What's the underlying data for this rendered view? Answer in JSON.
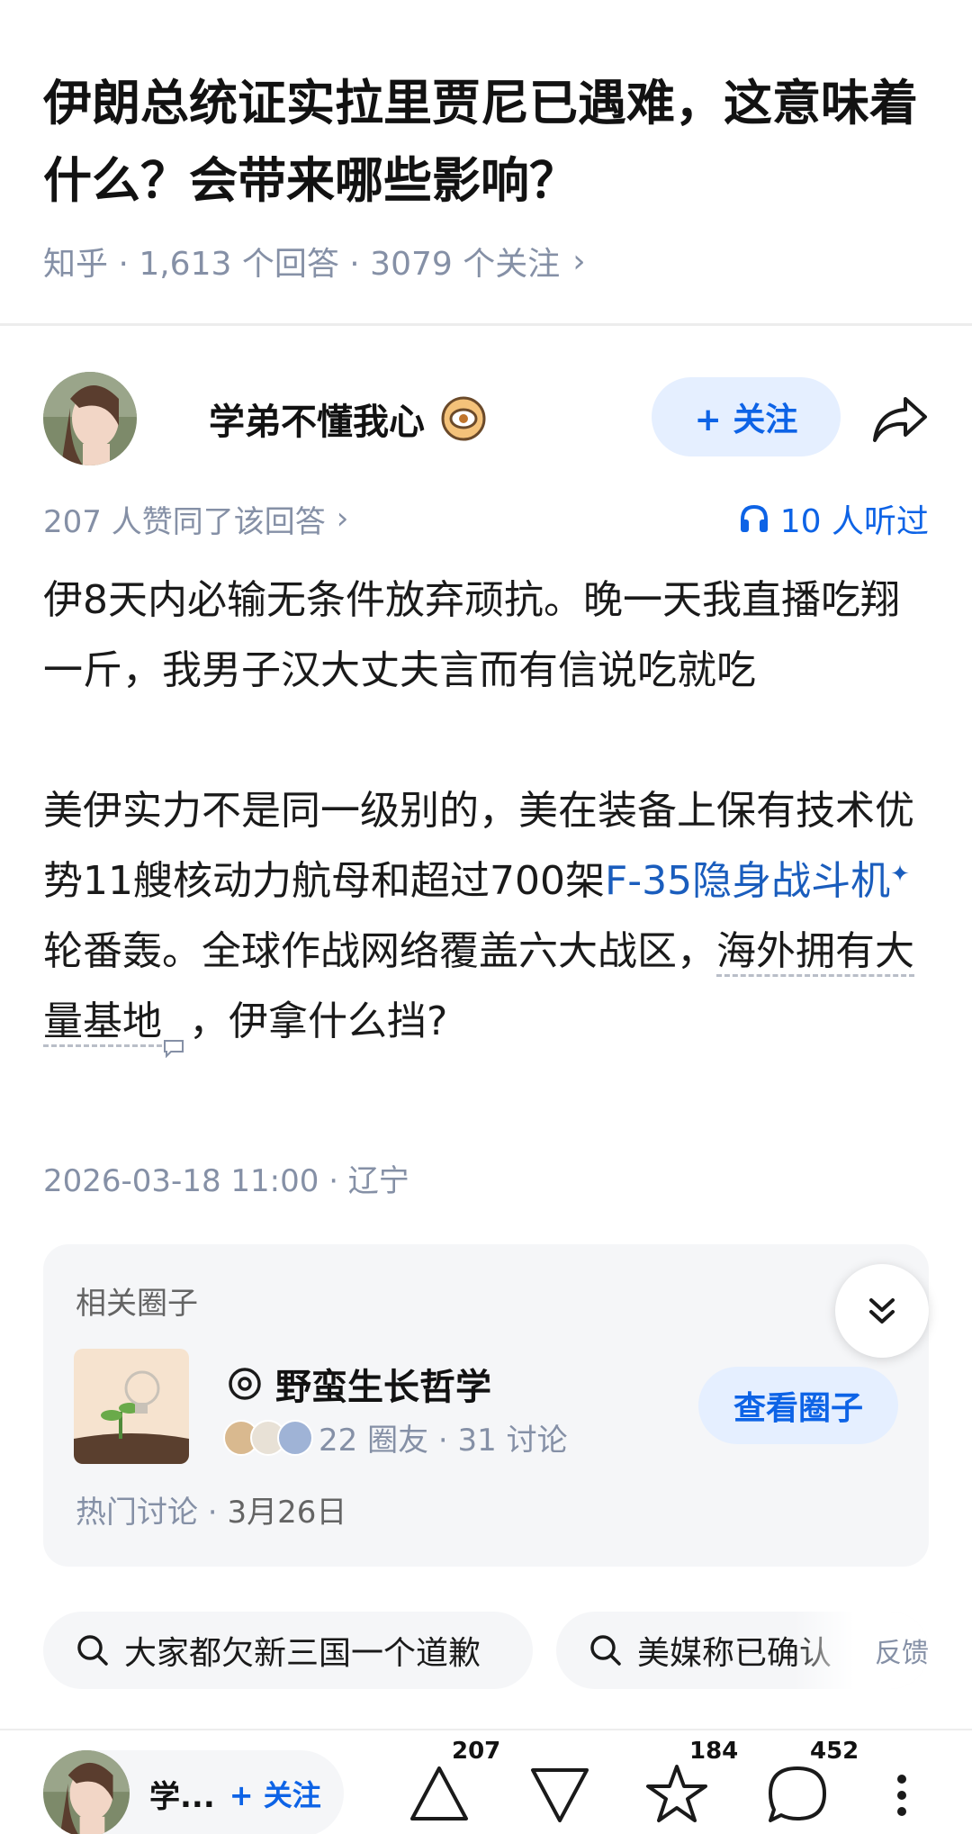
{
  "question": {
    "title": "伊朗总统证实拉里贾尼已遇难，这意味着什么？会带来哪些影响？",
    "meta": "知乎 · 1,613 个回答 · 3079 个关注",
    "chevron": "›"
  },
  "answer": {
    "author_name": "学弟不懂我心",
    "follow_label": "+ 关注",
    "vote_summary": "207 人赞同了该回答",
    "chevron": "›",
    "listen_text": "10 人听过",
    "content": {
      "p1": "伊8天内必输无条件放弃顽抗。晚一天我直播吃翔一斤，我男子汉大丈夫言而有信说吃就吃",
      "p2_a": "美伊实力不是同一级别的，美在装备上保有技术优势11艘核动力航母和超过700架",
      "p2_link": "F-35隐身战斗机",
      "p2_spark": "✦",
      "p2_b": "轮番轰。全球作战网络覆盖六大战区，",
      "p2_dotted": "海外拥有大量基地",
      "p2_c": "，伊拿什么挡?"
    },
    "post_meta": "2026-03-18 11:00 · 辽宁"
  },
  "circle": {
    "header": "相关圈子",
    "name": "野蛮生长哲学",
    "stats": "22 圈友 · 31 讨论",
    "view_label": "查看圈子",
    "foot_label": "热门讨论 · ",
    "foot_date": "3月26日"
  },
  "searches": {
    "chip1": "大家都欠新三国一个道歉",
    "chip2": "美媒称已确认",
    "feedback": "反馈"
  },
  "bottom_bar": {
    "author_short": "学...",
    "follow_label": "+ 关注",
    "upvote_count": "207",
    "favorite_count": "184",
    "comment_count": "452"
  },
  "colors": {
    "accent": "#0d63e6",
    "accent_bg": "#e5efff",
    "muted": "#8590a6",
    "card_bg": "#f5f6f8"
  }
}
